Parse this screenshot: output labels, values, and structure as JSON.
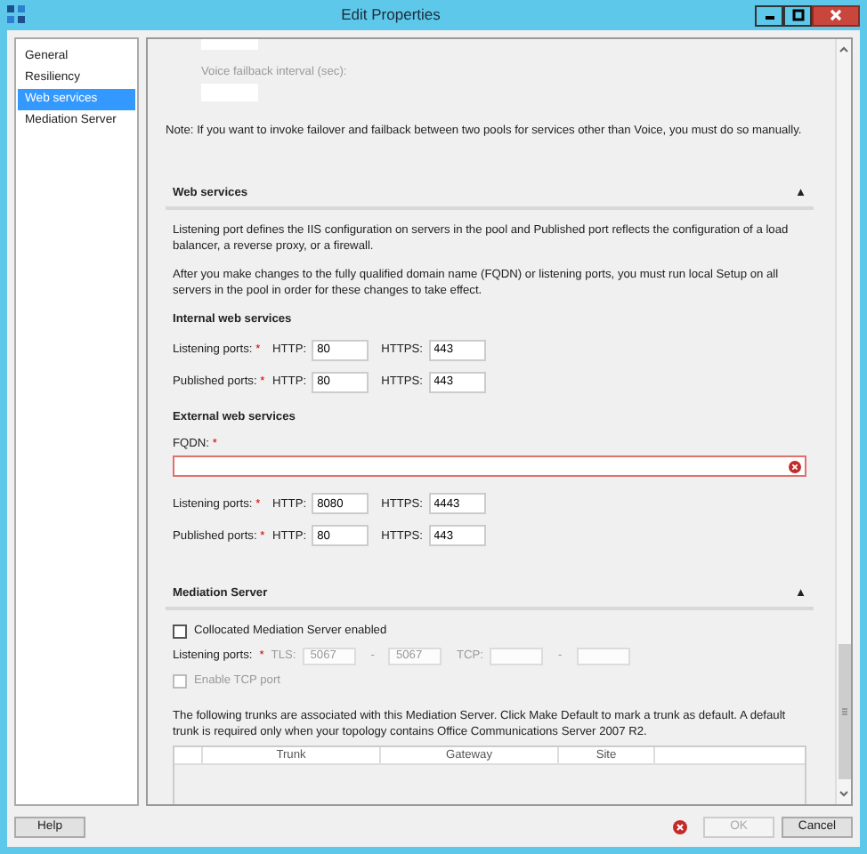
{
  "window": {
    "title": "Edit Properties"
  },
  "sidebar": {
    "items": [
      {
        "label": "General",
        "selected": false
      },
      {
        "label": "Resiliency",
        "selected": false
      },
      {
        "label": "Web services",
        "selected": true
      },
      {
        "label": "Mediation Server",
        "selected": false
      }
    ]
  },
  "resiliency": {
    "failback_label": "Voice failback interval (sec):",
    "note": "Note: If you want to invoke failover and failback between two pools for services other than Voice, you must do so manually."
  },
  "web_services": {
    "title": "Web services",
    "collapse_glyph": "▲",
    "paragraphs": [
      "Listening port defines the IIS configuration on servers in the pool and Published port reflects the configuration of a load balancer, a reverse proxy, or a firewall.",
      "After you make changes to the fully qualified domain name (FQDN) or listening ports, you must run local Setup on all servers in the pool in order for these changes to take effect."
    ],
    "internal": {
      "title": "Internal web services",
      "rows": [
        {
          "label": "Listening ports:",
          "required_mark": "*",
          "http_label": "HTTP:",
          "http": "80",
          "https_label": "HTTPS:",
          "https": "443"
        },
        {
          "label": "Published ports:",
          "required_mark": "*",
          "http_label": "HTTP:",
          "http": "80",
          "https_label": "HTTPS:",
          "https": "443"
        }
      ]
    },
    "external": {
      "title": "External web services",
      "fqdn_label": "FQDN:",
      "fqdn_required_mark": "*",
      "fqdn_error": true,
      "rows": [
        {
          "label": "Listening ports:",
          "required_mark": "*",
          "http_label": "HTTP:",
          "http": "8080",
          "https_label": "HTTPS:",
          "https": "4443"
        },
        {
          "label": "Published ports:",
          "required_mark": "*",
          "http_label": "HTTP:",
          "http": "80",
          "https_label": "HTTPS:",
          "https": "443"
        }
      ]
    }
  },
  "mediation": {
    "title": "Mediation Server",
    "collapse_glyph": "▲",
    "collocated": {
      "label": "Collocated Mediation Server enabled",
      "checked": false,
      "disabled": false
    },
    "ports": {
      "label": "Listening ports:",
      "required_mark": "*",
      "disabled": true,
      "tls_label": "TLS:",
      "tls_from": "5067",
      "dash_1": "-",
      "tls_to": "5067",
      "tcp_label": "TCP:",
      "dash_2": "-"
    },
    "enable_tcp": {
      "label": "Enable TCP port",
      "checked": false,
      "disabled": true
    },
    "trunks_note": "The following trunks are associated with this Mediation Server. Click Make Default to mark a trunk as default. A default trunk is required only when your topology contains Office Communications Server 2007 R2.",
    "table": {
      "columns": [
        "Trunk",
        "Gateway",
        "Site"
      ]
    }
  },
  "buttons": [
    {
      "label": "Help",
      "disabled": false
    },
    {
      "label": "OK",
      "disabled": true
    },
    {
      "label": "Cancel",
      "disabled": false
    }
  ]
}
